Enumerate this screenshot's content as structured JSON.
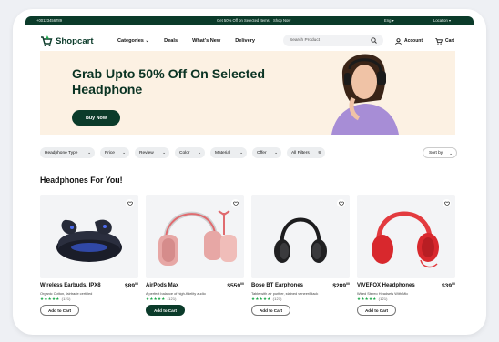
{
  "topbar": {
    "phone": "+00123456789",
    "promo": "Get 50% Off on Selected Items",
    "shop_now": "Shop Now",
    "language": "Eng ▾",
    "location": "Location ▾"
  },
  "nav": {
    "logo": "Shopcart",
    "menu": [
      "Categories ⌄",
      "Deals",
      "What's New",
      "Delivery"
    ],
    "search_placeholder": "Search Product",
    "account": "Account",
    "cart": "Cart"
  },
  "hero": {
    "title": "Grab Upto 50% Off On Selected Headphone",
    "button": "Buy Now"
  },
  "filters": [
    "Headphone Type",
    "Price",
    "Review",
    "Color",
    "Material",
    "Offer",
    "All Filters"
  ],
  "sort": "Sort by",
  "section_title": "Headphones For You!",
  "products": [
    {
      "name": "Wireless Earbuds, IPX8",
      "price_main": "$89",
      "price_cents": "00",
      "desc": "Organic Cotton, fairtrade certified",
      "stars": "★★★★★",
      "reviews": "(121)",
      "add": "Add to Cart",
      "active": false
    },
    {
      "name": "AirPods Max",
      "price_main": "$559",
      "price_cents": "00",
      "desc": "A perfect balance of high-fidelity audio",
      "stars": "★★★★★",
      "reviews": "(121)",
      "add": "Add to Cart",
      "active": true
    },
    {
      "name": "Bose BT Earphones",
      "price_main": "$289",
      "price_cents": "00",
      "desc": "Table with air purifier, stained veneer/black",
      "stars": "★★★★★",
      "reviews": "(121)",
      "add": "Add to Cart",
      "active": false
    },
    {
      "name": "VIVEFOX Headphones",
      "price_main": "$39",
      "price_cents": "00",
      "desc": "Wired Stereo Headsets With Mic",
      "stars": "★★★★★",
      "reviews": "(121)",
      "add": "Add to Cart",
      "active": false
    }
  ],
  "colors": {
    "brand": "#0b3b2a",
    "hero_bg": "#fcf1e3",
    "star": "#1ea84b"
  }
}
